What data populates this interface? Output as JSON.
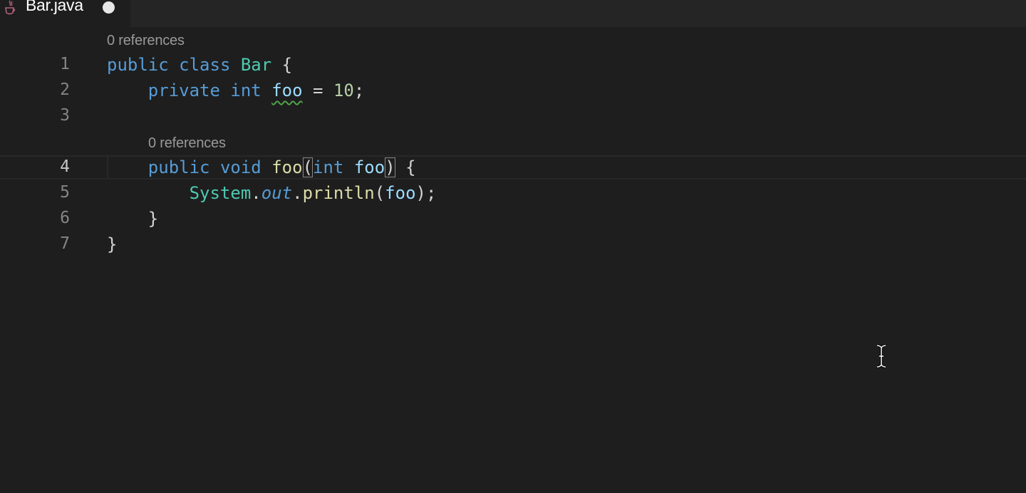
{
  "tab": {
    "title": "Bar.java",
    "icon": "java-icon",
    "dirty": true
  },
  "editor": {
    "codelens": [
      "0 references",
      "0 references"
    ],
    "lines": [
      {
        "number": "1",
        "text": "public class Bar {"
      },
      {
        "number": "2",
        "text": "    private int foo = 10;"
      },
      {
        "number": "3",
        "text": ""
      },
      {
        "number": "4",
        "text": "    public void foo(int foo) {"
      },
      {
        "number": "5",
        "text": "        System.out.println(foo);"
      },
      {
        "number": "6",
        "text": "    }"
      },
      {
        "number": "7",
        "text": "}"
      }
    ],
    "active_line": "4",
    "tokens": {
      "l1": {
        "public": "public",
        "class": "class",
        "name": "Bar",
        "brace": "{"
      },
      "l2": {
        "private": "private",
        "int": "int",
        "field": "foo",
        "eq": "=",
        "value": "10",
        "semi": ";"
      },
      "l4": {
        "public": "public",
        "void": "void",
        "method": "foo",
        "lparen": "(",
        "int": "int",
        "param": "foo",
        "rparen": ")",
        "brace": "{"
      },
      "l5": {
        "system": "System",
        "dot1": ".",
        "out": "out",
        "dot2": ".",
        "println": "println",
        "lparen": "(",
        "arg": "foo",
        "rparen": ")",
        "semi": ";"
      },
      "l6": {
        "brace": "}"
      },
      "l7": {
        "brace": "}"
      }
    }
  },
  "colors": {
    "background": "#1e1e1e",
    "keyword": "#569cd6",
    "type": "#4ec9b0",
    "variable": "#9cdcfe",
    "function": "#dcdcaa",
    "number": "#b5cea8",
    "warning_squiggle": "#4ea24a"
  }
}
